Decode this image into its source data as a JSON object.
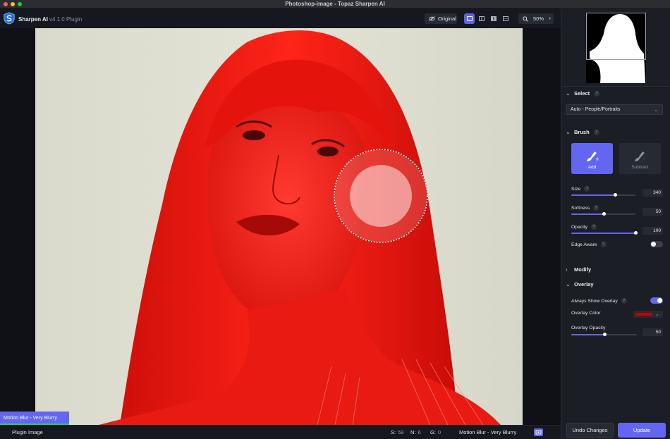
{
  "window": {
    "title": "Photoshop-image - Topaz Sharpen AI"
  },
  "toolbar": {
    "app_name": "Sharpen AI",
    "app_version": "v4.1.0 Plugin",
    "original_label": "Original",
    "zoom_value": "50%",
    "view_modes": [
      "single-view",
      "split-view",
      "side-by-side",
      "quad-view"
    ],
    "active_view": "single-view"
  },
  "canvas": {
    "model_label": "Motion Blur - Very Blurry",
    "overlay_color": "#ff1a1a"
  },
  "status": {
    "image_name": "Plugin Image",
    "s_label": "S:",
    "s_value": "59",
    "n_label": "N:",
    "n_value": "6",
    "g_label": "G:",
    "g_value": "0",
    "model": "Motion Blur - Very Blurry"
  },
  "panel": {
    "select": {
      "title": "Select",
      "mode": "Auto - People/Portraits"
    },
    "brush": {
      "title": "Brush",
      "add_label": "Add",
      "subtract_label": "Subtract",
      "size_label": "Size",
      "size_value": "340",
      "size_fraction": 0.68,
      "softness_label": "Softness",
      "softness_value": "50",
      "softness_fraction": 0.5,
      "opacity_label": "Opacity",
      "opacity_value": "100",
      "opacity_fraction": 1.0,
      "edge_aware_label": "Edge Aware",
      "edge_aware_on": false
    },
    "modify": {
      "title": "Modify"
    },
    "overlay": {
      "title": "Overlay",
      "always_show_label": "Always Show Overlay",
      "always_show_on": true,
      "color_label": "Overlay Color",
      "color_value": "#c40000",
      "opacity_label": "Overlay Opacity",
      "opacity_value": "50",
      "opacity_fraction": 0.5
    },
    "undo_label": "Undo Changes",
    "update_label": "Update"
  },
  "colors": {
    "accent": "#6366f1",
    "panel_bg": "#1b1e25",
    "app_bg": "#15181e"
  }
}
